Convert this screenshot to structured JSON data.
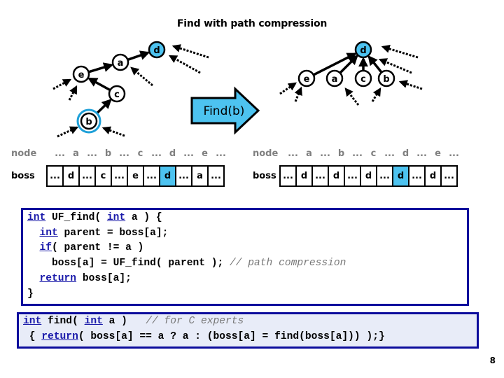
{
  "title": "Find with path compression",
  "colors": {
    "highlight": "#4dc3f0",
    "code_border": "#0c0c9c",
    "keyword": "#1a1aaa",
    "comment": "#777777"
  },
  "before_tree": {
    "nodes": [
      "e",
      "a",
      "d",
      "c",
      "b"
    ],
    "root": "d",
    "queried": "b",
    "edges": [
      [
        "b",
        "c"
      ],
      [
        "c",
        "e"
      ],
      [
        "e",
        "a"
      ],
      [
        "a",
        "d"
      ]
    ]
  },
  "after_tree": {
    "nodes": [
      "d",
      "e",
      "a",
      "c",
      "b"
    ],
    "root": "d",
    "edges": [
      [
        "e",
        "d"
      ],
      [
        "a",
        "d"
      ],
      [
        "c",
        "d"
      ],
      [
        "b",
        "d"
      ]
    ]
  },
  "operation_arrow": {
    "label": "Find(b)"
  },
  "before_table": {
    "node_header": "node",
    "boss_header": "boss",
    "node_cells": [
      "...",
      "a",
      "...",
      "b",
      "...",
      "c",
      "...",
      "d",
      "...",
      "e",
      "..."
    ],
    "boss_cells": [
      "...",
      "d",
      "...",
      "c",
      "...",
      "e",
      "...",
      "d",
      "...",
      "a",
      "..."
    ],
    "highlight_index": 7
  },
  "after_table": {
    "node_header": "node",
    "boss_header": "boss",
    "node_cells": [
      "...",
      "a",
      "...",
      "b",
      "...",
      "c",
      "...",
      "d",
      "...",
      "e",
      "..."
    ],
    "boss_cells": [
      "...",
      "d",
      "...",
      "d",
      "...",
      "d",
      "...",
      "d",
      "...",
      "d",
      "..."
    ],
    "highlight_index": 7
  },
  "code_block_1": {
    "lines": [
      [
        {
          "t": "int",
          "k": "kw"
        },
        {
          "t": " UF_find( "
        },
        {
          "t": "int",
          "k": "kw"
        },
        {
          "t": " a ) {"
        }
      ],
      [
        {
          "t": "  "
        },
        {
          "t": "int",
          "k": "kw"
        },
        {
          "t": " parent = boss[a];"
        }
      ],
      [
        {
          "t": "  "
        },
        {
          "t": "if",
          "k": "kw"
        },
        {
          "t": "( parent != a )"
        }
      ],
      [
        {
          "t": "    boss[a] = UF_find( parent ); "
        },
        {
          "t": "// path compression",
          "k": "cmt"
        }
      ],
      [
        {
          "t": "  "
        },
        {
          "t": "return",
          "k": "kw"
        },
        {
          "t": " boss[a];"
        }
      ],
      [
        {
          "t": "}"
        }
      ]
    ]
  },
  "code_block_2": {
    "lines": [
      [
        {
          "t": "int",
          "k": "kw"
        },
        {
          "t": " find( "
        },
        {
          "t": "int",
          "k": "kw"
        },
        {
          "t": " a )   "
        },
        {
          "t": "// for C experts",
          "k": "cmt"
        }
      ],
      [
        {
          "t": " { "
        },
        {
          "t": "return",
          "k": "kw"
        },
        {
          "t": "( boss[a] == a ? a : (boss[a] = find(boss[a])) );}"
        }
      ]
    ]
  },
  "page_number": "8"
}
